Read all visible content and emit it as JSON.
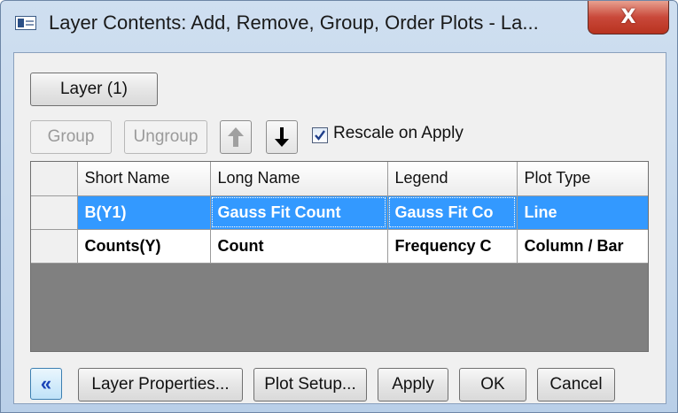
{
  "window": {
    "title": "Layer Contents: Add, Remove, Group, Order Plots - La...",
    "close_glyph": "X"
  },
  "toolbar": {
    "layer_button": "Layer (1)",
    "group_button": "Group",
    "ungroup_button": "Ungroup",
    "move_up_icon": "arrow-up-icon",
    "move_down_icon": "arrow-down-icon",
    "rescale_label": "Rescale on Apply",
    "rescale_checked": true
  },
  "table": {
    "columns": [
      "Short Name",
      "Long Name",
      "Legend",
      "Plot Type"
    ],
    "rows": [
      {
        "short_name": "B(Y1)",
        "long_name": "Gauss Fit Count",
        "legend": "Gauss Fit Co",
        "plot_type": "Line",
        "selected": true
      },
      {
        "short_name": "Counts(Y)",
        "long_name": "Count",
        "legend": "Frequency C",
        "plot_type": "Column / Bar",
        "selected": false
      }
    ]
  },
  "footer": {
    "collapse_glyph": "«",
    "layer_properties": "Layer Properties...",
    "plot_setup": "Plot Setup...",
    "apply": "Apply",
    "ok": "OK",
    "cancel": "Cancel"
  },
  "colors": {
    "selection": "#3399ff",
    "empty_grid": "#808080",
    "close_button": "#c9483a"
  }
}
